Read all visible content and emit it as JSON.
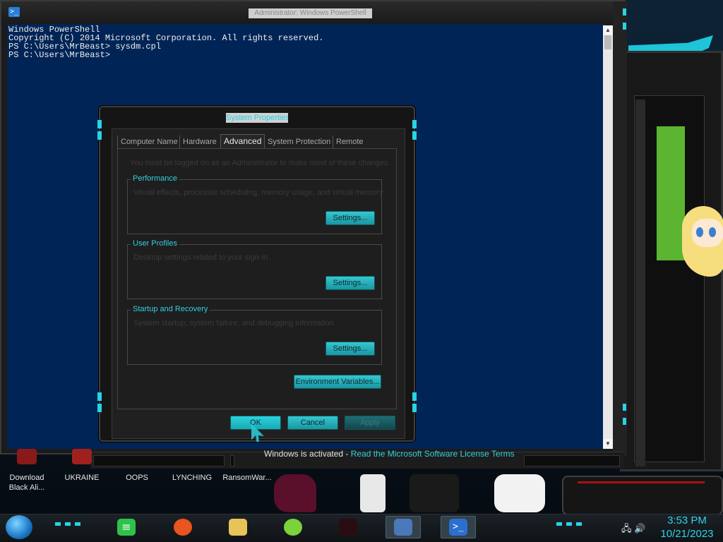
{
  "powershell": {
    "title": "Administrator: Windows PowerShell",
    "console_lines": [
      "Windows PowerShell",
      "Copyright (C) 2014 Microsoft Corporation. All rights reserved.",
      "",
      "PS C:\\Users\\MrBeast> sysdm.cpl",
      "PS C:\\Users\\MrBeast>"
    ],
    "icon": "powershell-icon"
  },
  "dialog": {
    "title": "System Properties",
    "tabs": [
      "Computer Name",
      "Hardware",
      "Advanced",
      "System Protection",
      "Remote"
    ],
    "active_tab": "Advanced",
    "note": "You must be logged on as an Administrator to make most of these changes.",
    "groups": [
      {
        "title": "Performance",
        "desc": "Visual effects, processor scheduling, memory usage, and virtual memory",
        "button": "Settings..."
      },
      {
        "title": "User Profiles",
        "desc": "Desktop settings related to your sign-in",
        "button": "Settings..."
      },
      {
        "title": "Startup and Recovery",
        "desc": "System startup, system failure, and debugging information",
        "button": "Settings..."
      }
    ],
    "env_button": "Environment Variables...",
    "ok": "OK",
    "cancel": "Cancel",
    "apply": "Apply"
  },
  "activation": {
    "text": "Windows is activated",
    "link": "Read the Microsoft Software License Terms"
  },
  "desktop_icons": [
    {
      "label": "Download Black Ali...",
      "icon": "app-icon"
    },
    {
      "label": "UKRAINE",
      "icon": "flag-icon"
    },
    {
      "label": "OOPS",
      "icon": "file-icon"
    },
    {
      "label": "LYNCHING",
      "icon": "file-icon"
    },
    {
      "label": "RansomWar...",
      "icon": "file-icon"
    }
  ],
  "taskbar": {
    "apps": [
      {
        "name": "notes",
        "icon": "notes-icon"
      },
      {
        "name": "firefox",
        "icon": "firefox-icon"
      },
      {
        "name": "file-explorer",
        "icon": "folder-icon"
      },
      {
        "name": "lime",
        "icon": "lime-icon"
      },
      {
        "name": "media",
        "icon": "media-icon"
      },
      {
        "name": "system-properties",
        "icon": "computer-icon"
      },
      {
        "name": "powershell",
        "icon": "powershell-icon"
      }
    ],
    "time": "3:53 PM",
    "date": "10/21/2023"
  },
  "colors": {
    "accent": "#27d3e6",
    "console_bg": "#012456",
    "button": "#2ab8c4"
  }
}
